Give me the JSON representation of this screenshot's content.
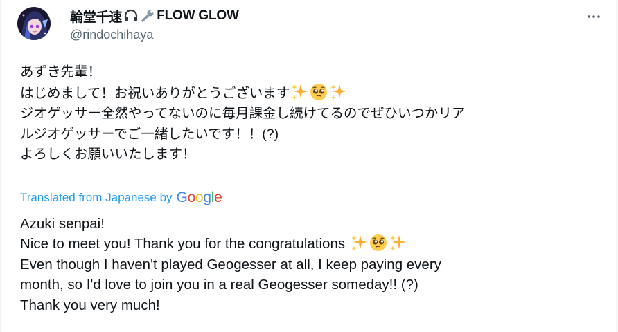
{
  "author": {
    "display_name": "輪堂千速",
    "display_suffix": "FLOW GLOW",
    "name_emojis": [
      "headphone-icon",
      "wrench-icon"
    ],
    "handle": "@rindochihaya"
  },
  "tweet": {
    "lines": [
      "あずき先輩！",
      "はじめまして！お祝いありがとうございます",
      "ジオゲッサー全然やってないのに毎月課金し続けてるのでぜひいつかリア",
      "ルジオゲッサーでご一緒したいです！！(?)",
      "よろしくお願いいたします！"
    ],
    "line2_emojis": [
      "sparkles-icon",
      "pleading-face-icon",
      "sparkles-icon"
    ]
  },
  "translation_bar": {
    "label": "Translated from Japanese by",
    "provider": "Google",
    "provider_colors": [
      "#4285F4",
      "#EA4335",
      "#FBBC05",
      "#4285F4",
      "#34A853",
      "#EA4335"
    ]
  },
  "translation": {
    "lines": [
      "Azuki senpai!",
      "Nice to meet you! Thank you for the congratulations",
      "Even though I haven't played Geogesser at all, I keep paying every",
      "month, so I'd love to join you in a real Geogesser someday!! (?)",
      "Thank you very much!"
    ],
    "line2_emojis": [
      "sparkles-icon",
      "pleading-face-icon",
      "sparkles-icon"
    ]
  },
  "colors": {
    "text": "#0f1419",
    "secondary": "#536471",
    "link": "#1d9bf0"
  }
}
